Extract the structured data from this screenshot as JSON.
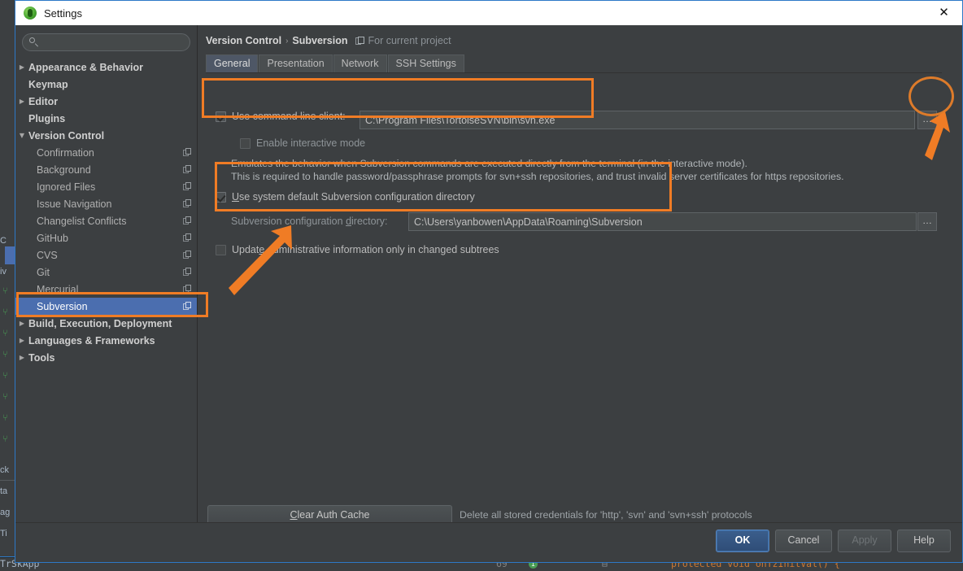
{
  "window": {
    "title": "Settings",
    "app_icon": "android-studio-icon",
    "close_label": "✕"
  },
  "sidebar": {
    "search": {
      "value": "",
      "placeholder": "",
      "icon": "search-icon"
    },
    "items": [
      {
        "label": "Appearance & Behavior",
        "level": 0,
        "arrow": "▶",
        "bold": true,
        "copy": false,
        "selected": false
      },
      {
        "label": "Keymap",
        "level": 0,
        "arrow": "",
        "bold": true,
        "copy": false,
        "selected": false
      },
      {
        "label": "Editor",
        "level": 0,
        "arrow": "▶",
        "bold": true,
        "copy": false,
        "selected": false
      },
      {
        "label": "Plugins",
        "level": 0,
        "arrow": "",
        "bold": true,
        "copy": false,
        "selected": false
      },
      {
        "label": "Version Control",
        "level": 0,
        "arrow": "▼",
        "bold": true,
        "copy": false,
        "selected": false
      },
      {
        "label": "Confirmation",
        "level": 1,
        "arrow": "",
        "bold": false,
        "copy": true,
        "selected": false
      },
      {
        "label": "Background",
        "level": 1,
        "arrow": "",
        "bold": false,
        "copy": true,
        "selected": false
      },
      {
        "label": "Ignored Files",
        "level": 1,
        "arrow": "",
        "bold": false,
        "copy": true,
        "selected": false
      },
      {
        "label": "Issue Navigation",
        "level": 1,
        "arrow": "",
        "bold": false,
        "copy": true,
        "selected": false
      },
      {
        "label": "Changelist Conflicts",
        "level": 1,
        "arrow": "",
        "bold": false,
        "copy": true,
        "selected": false
      },
      {
        "label": "GitHub",
        "level": 1,
        "arrow": "",
        "bold": false,
        "copy": true,
        "selected": false
      },
      {
        "label": "CVS",
        "level": 1,
        "arrow": "",
        "bold": false,
        "copy": true,
        "selected": false
      },
      {
        "label": "Git",
        "level": 1,
        "arrow": "",
        "bold": false,
        "copy": true,
        "selected": false
      },
      {
        "label": "Mercurial",
        "level": 1,
        "arrow": "",
        "bold": false,
        "copy": true,
        "selected": false
      },
      {
        "label": "Subversion",
        "level": 1,
        "arrow": "",
        "bold": false,
        "copy": true,
        "selected": true
      },
      {
        "label": "Build, Execution, Deployment",
        "level": 0,
        "arrow": "▶",
        "bold": true,
        "copy": false,
        "selected": false
      },
      {
        "label": "Languages & Frameworks",
        "level": 0,
        "arrow": "▶",
        "bold": true,
        "copy": false,
        "selected": false
      },
      {
        "label": "Tools",
        "level": 0,
        "arrow": "▶",
        "bold": true,
        "copy": false,
        "selected": false
      }
    ]
  },
  "main": {
    "breadcrumb": {
      "root": "Version Control",
      "separator": "›",
      "leaf": "Subversion",
      "scope_icon": "project-scope-icon",
      "scope_text": "For current project"
    },
    "tabs": [
      {
        "label": "General",
        "active": true
      },
      {
        "label": "Presentation",
        "active": false
      },
      {
        "label": "Network",
        "active": false
      },
      {
        "label": "SSH Settings",
        "active": false
      }
    ],
    "command_line": {
      "checkbox_label": "Use command line client:",
      "checked": true,
      "path_value": "C:\\Program Files\\TortoiseSVN\\bin\\svn.exe",
      "browse_label": "…"
    },
    "interactive_mode": {
      "label": "Enable interactive mode",
      "checked": false,
      "description_line1": "Emulates the behavior when Subversion commands are executed directly from the terminal (in the interactive mode).",
      "description_line2": "This is required to handle password/passphrase prompts for svn+ssh repositories, and trust invalid server certificates for https repositories."
    },
    "config_dir": {
      "use_default_label": "Use system default Subversion configuration directory",
      "use_default_checked": true,
      "field_label": "Subversion configuration directory:",
      "field_value": "C:\\Users\\yanbowen\\AppData\\Roaming\\Subversion",
      "browse_label": "…"
    },
    "update_admin": {
      "label": "Update administrative information only in changed subtrees",
      "checked": false
    },
    "auth_cache": {
      "button_label": "Clear Auth Cache",
      "note": "Delete all stored credentials for 'http', 'svn' and 'svn+ssh' protocols"
    }
  },
  "footer": {
    "buttons": [
      {
        "label": "OK",
        "style": "primary",
        "disabled": false
      },
      {
        "label": "Cancel",
        "style": "normal",
        "disabled": false
      },
      {
        "label": "Apply",
        "style": "normal",
        "disabled": true
      },
      {
        "label": "Help",
        "style": "normal",
        "disabled": false
      }
    ]
  },
  "background": {
    "status_file": "TrSkApp",
    "line_number": "69",
    "code_snippet": "protected void onTzInitVal() {",
    "side_chars": [
      "C",
      "iv",
      "ck",
      "ta",
      "ag",
      "Ti"
    ]
  },
  "annotations": {
    "color": "#f07c25",
    "boxes": [
      {
        "name": "command-line-client-highlight"
      },
      {
        "name": "config-directory-highlight"
      },
      {
        "name": "subversion-sidebar-highlight"
      }
    ],
    "circles": [
      {
        "name": "browse-button-highlight"
      }
    ],
    "arrows": [
      {
        "name": "arrow-to-browse-button"
      },
      {
        "name": "arrow-to-update-admin-checkbox"
      }
    ]
  }
}
